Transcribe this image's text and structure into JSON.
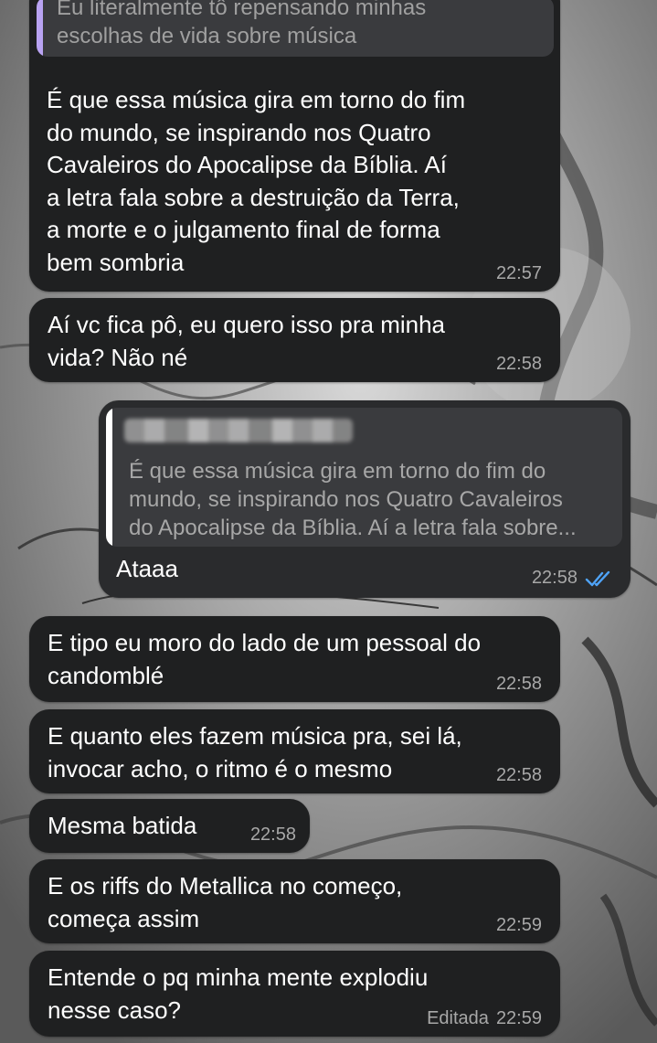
{
  "theme": {
    "bubble_color": "#1f2021",
    "outgoing_bubble_color": "#2a2b2d",
    "quote_bar_color": "#b9a3f2",
    "read_ticks_color": "#4fa3f7"
  },
  "reply_preview": {
    "text": "Eu literalmente tô repensando minhas\nescolhas de vida sobre música"
  },
  "messages": [
    {
      "text": "É que essa música gira em torno do fim\ndo mundo, se inspirando nos Quatro\nCavaleiros do Apocalipse da Bíblia. Aí\na letra fala sobre a destruição da Terra,\na morte e o julgamento final de forma\nbem sombria",
      "time": "22:57"
    },
    {
      "text": "Aí vc fica pô, eu quero isso pra minha\nvida? Não né",
      "time": "22:58"
    },
    {
      "direction": "outgoing",
      "quote_text": "É que essa música gira em torno do fim do\nmundo, se inspirando nos Quatro Cavaleiros\ndo Apocalipse da Bíblia. Aí a letra fala sobre...",
      "text": "Ataaa",
      "time": "22:58",
      "status_icon": "double-check-read-icon"
    },
    {
      "text": "E tipo eu moro do lado de um pessoal do\ncandomblé",
      "time": "22:58"
    },
    {
      "text": "E quanto eles fazem música pra, sei lá,\ninvocar acho, o ritmo é o mesmo",
      "time": "22:58"
    },
    {
      "text": "Mesma batida",
      "time": "22:58"
    },
    {
      "text": "E os riffs do Metallica no começo,\ncomeça assim",
      "time": "22:59"
    },
    {
      "text": "Entende o pq minha mente explodiu\nnesse caso?",
      "edited_label": "Editada",
      "time": "22:59"
    }
  ]
}
